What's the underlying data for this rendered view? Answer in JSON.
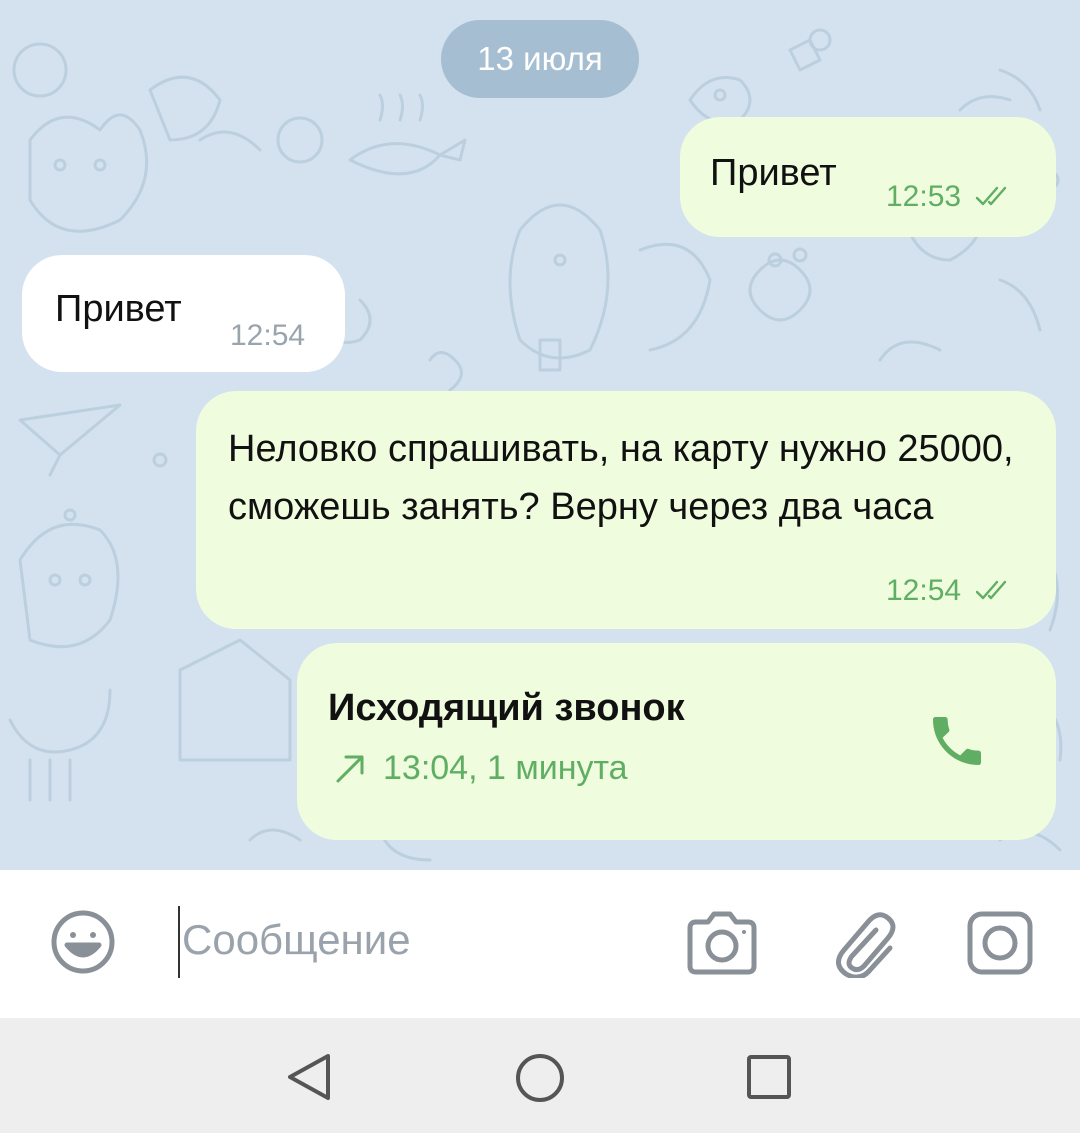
{
  "chat": {
    "date_separator": "13 июля",
    "messages": [
      {
        "direction": "outgoing",
        "text": "Привет",
        "time": "12:53",
        "status": "read"
      },
      {
        "direction": "incoming",
        "text": "Привет",
        "time": "12:54"
      },
      {
        "direction": "outgoing",
        "text": "Неловко спрашивать, на карту нужно 25000, сможешь занять? Верну через два часа",
        "time": "12:54",
        "status": "read"
      }
    ],
    "call": {
      "title": "Исходящий звонок",
      "details": "13:04, 1 минута"
    }
  },
  "input": {
    "placeholder": "Сообщение"
  },
  "icons": {
    "emoji": "emoji-icon",
    "camera": "camera-icon",
    "attach": "paperclip-icon",
    "video_message": "video-message-icon",
    "call": "phone-icon",
    "outgoing_arrow": "outgoing-arrow-icon",
    "read_ticks": "double-check-icon"
  },
  "colors": {
    "chat_background": "#d3e2ee",
    "outgoing_bubble": "#effcde",
    "incoming_bubble": "#ffffff",
    "accent_green": "#5fae63",
    "icon_gray": "#8a9097"
  }
}
